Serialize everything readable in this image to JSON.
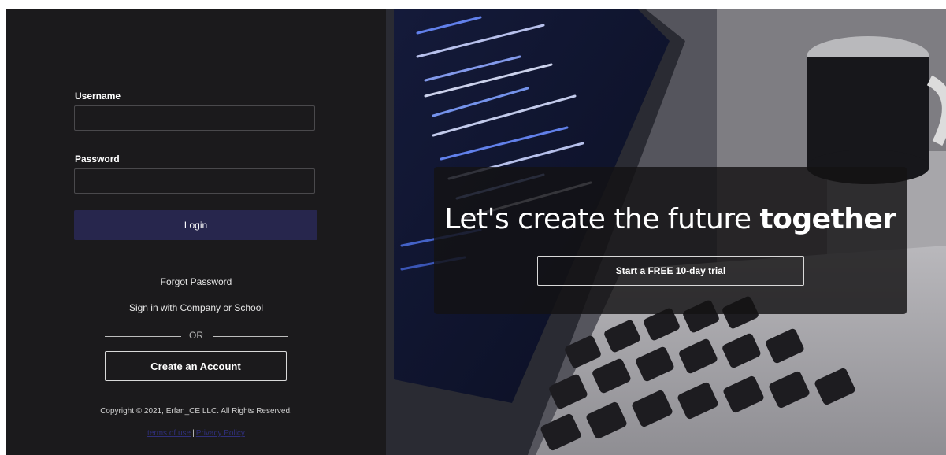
{
  "login": {
    "username_label": "Username",
    "username_value": "",
    "password_label": "Password",
    "password_value": "",
    "login_button": "Login",
    "forgot_password": "Forgot Password",
    "sign_in_company": "Sign in with Company or School",
    "or_text": "OR",
    "create_account": "Create an Account",
    "copyright": "Copyright © 2021, Erfan_CE LLC. All Rights Reserved.",
    "terms_link": "terms of use",
    "separator": "|",
    "privacy_link": "Privacy Policy"
  },
  "hero": {
    "title_prefix": "Let's create the future ",
    "title_bold": "together",
    "trial_button": "Start a FREE 10-day trial"
  },
  "colors": {
    "panel_bg": "#1b1a1c",
    "login_button_bg": "#27264d",
    "link_color": "#2f2f7a"
  }
}
